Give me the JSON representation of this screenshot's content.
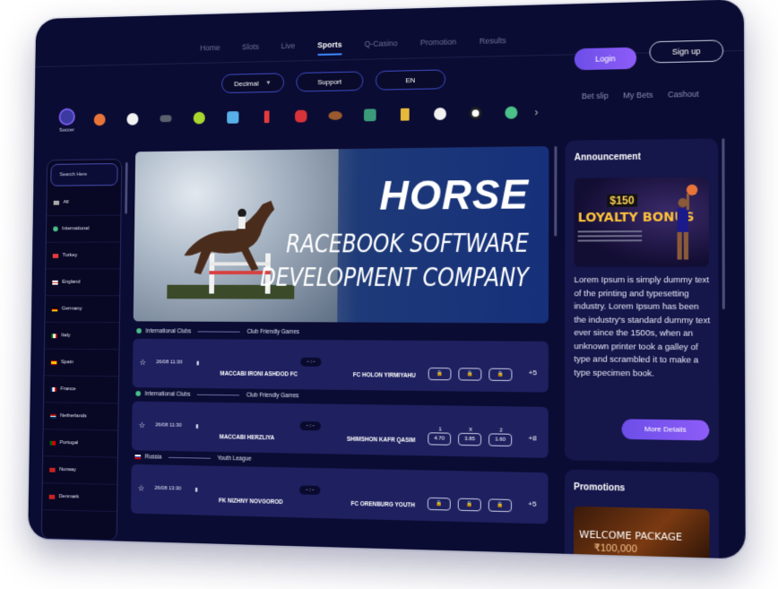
{
  "nav": {
    "items": [
      "Home",
      "Slots",
      "Live",
      "Sports",
      "Q-Casino",
      "Promotion",
      "Results"
    ],
    "active": "Sports"
  },
  "auth": {
    "login": "Login",
    "signup": "Sign up"
  },
  "controls": {
    "odds_format": "Decimal",
    "support": "Support",
    "language": "EN"
  },
  "sports": {
    "selected_label": "Soccer"
  },
  "betnav": {
    "betslip": "Bet slip",
    "mybets": "My Bets",
    "cashout": "Cashout"
  },
  "sidebar": {
    "search_placeholder": "Search Here",
    "items": [
      "All",
      "International",
      "Turkey",
      "England",
      "Germany",
      "Italy",
      "Spain",
      "France",
      "Netherlands",
      "Portugal",
      "Norway",
      "Denmark"
    ]
  },
  "banner": {
    "title": "HORSE",
    "line1": "RACEBOOK SOFTWARE",
    "line2": "DEVELOPMENT COMPANY"
  },
  "matches": [
    {
      "category": "International Clubs",
      "league": "Club Friendly Games",
      "date": "26/08 11:30",
      "score": "- : -",
      "home": "MACCABI IRONI ASHDOD FC",
      "away": "FC HOLON YIRMIYAHU",
      "more": "+5"
    },
    {
      "category": "International Clubs",
      "league": "Club Friendly Games",
      "date": "26/08 11:30",
      "score": "- : -",
      "home": "MACCABI HERZLIYA",
      "away": "SHIMSHON KAFR QASIM",
      "odd_labels": [
        "1",
        "X",
        "2"
      ],
      "odds": [
        "4.70",
        "3.85",
        "1.60"
      ],
      "more": "+8"
    },
    {
      "category": "Russia",
      "league": "Youth League",
      "date": "26/08 13:30",
      "score": "- : -",
      "home": "FK NIZHNY NOVGOROD",
      "away": "FC ORENBURG YOUTH",
      "more": "+5"
    }
  ],
  "announcement": {
    "title": "Announcement",
    "promo_amount": "$150",
    "promo_text": "LOYALTY BONUS",
    "text": "Lorem Ipsum is simply dummy text of the printing and typesetting industry. Lorem Ipsum has been the industry's standard dummy text ever since the 1500s, when an unknown printer took a galley of type and scrambled it to make a type specimen book.",
    "more_button": "More Details"
  },
  "promotions": {
    "title": "Promotions",
    "card_title": "WELCOME PACKAGE",
    "card_sub": "₹100,000"
  }
}
